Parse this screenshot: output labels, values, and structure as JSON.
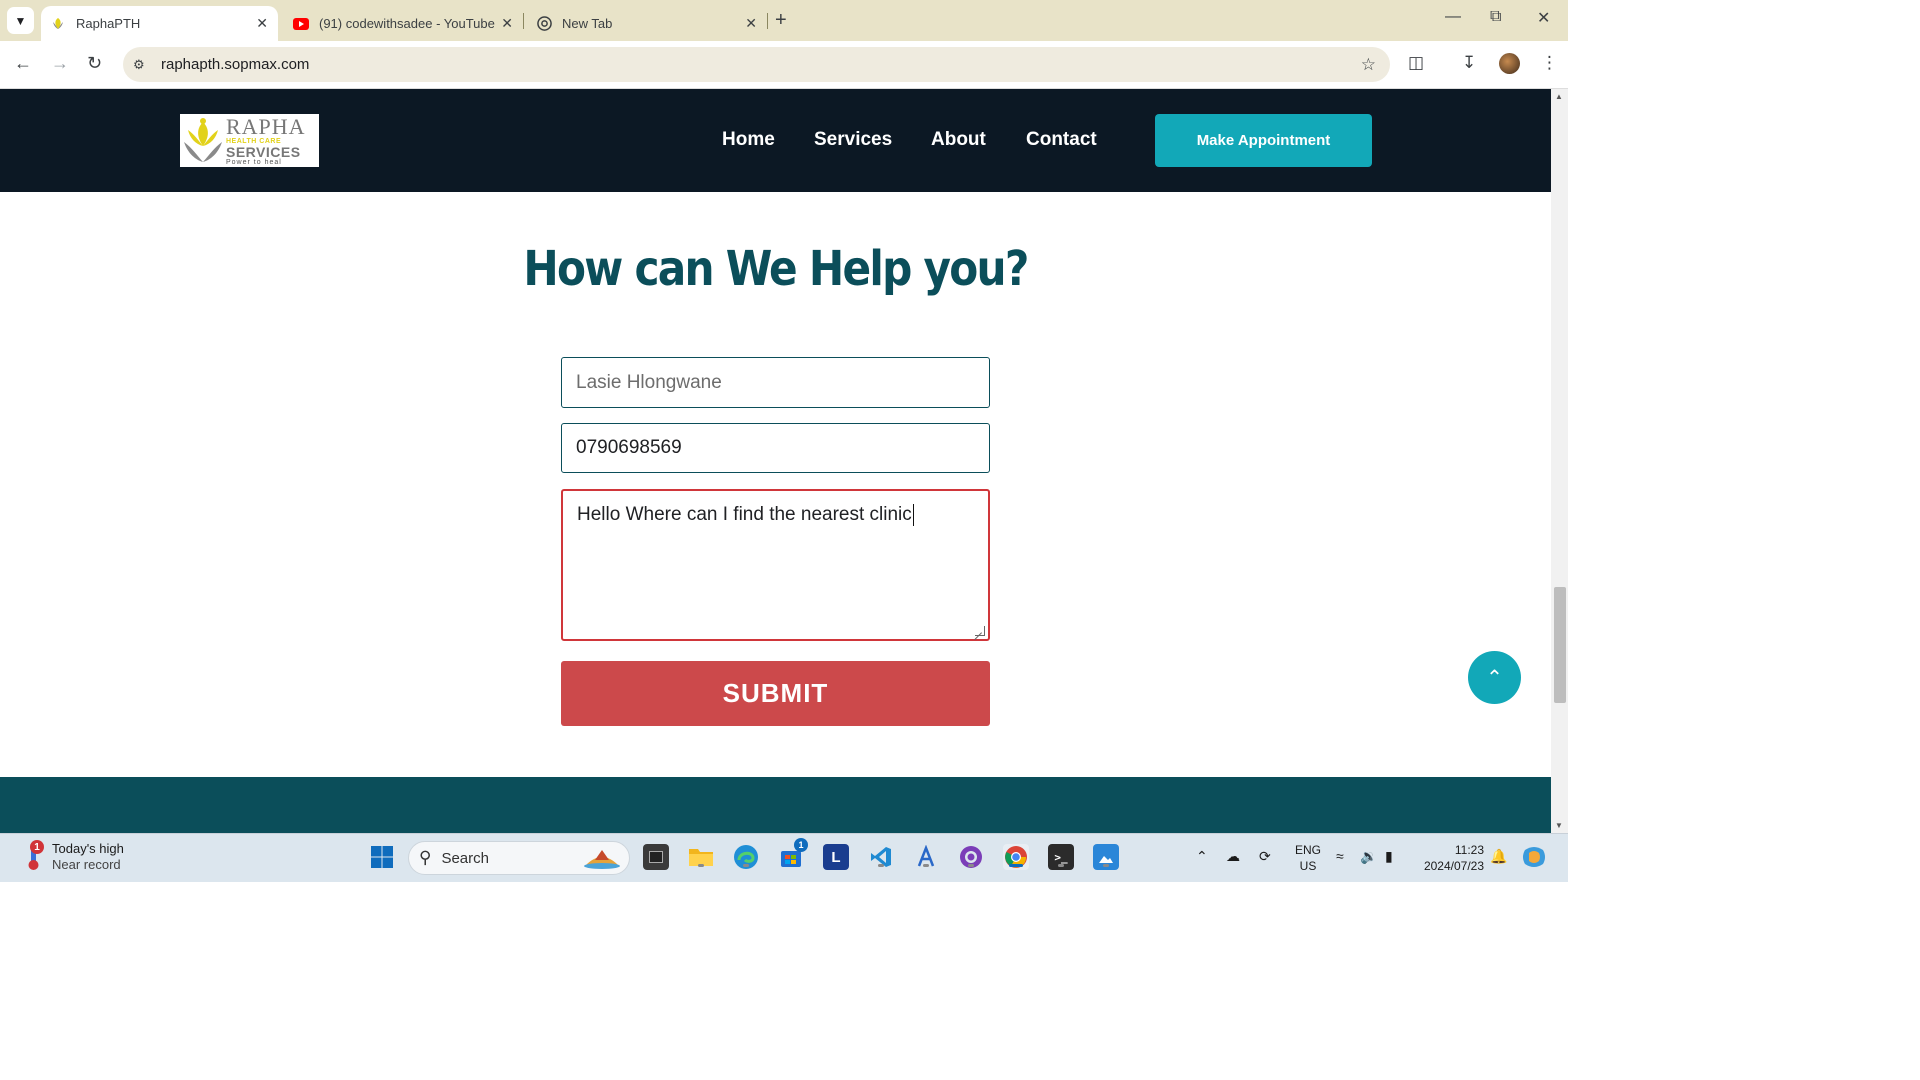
{
  "browser": {
    "tabs": [
      {
        "title": "RaphaPTH",
        "active": true
      },
      {
        "title": "(91) codewithsadee - YouTube",
        "active": false
      },
      {
        "title": "New Tab",
        "active": false
      }
    ],
    "url": "raphapth.sopmax.com"
  },
  "site": {
    "logo": {
      "line1": "RAPHA",
      "line2": "HEALTH CARE",
      "line3": "SERVICES",
      "line4": "Power to heal"
    },
    "nav": [
      "Home",
      "Services",
      "About",
      "Contact"
    ],
    "cta": "Make Appointment",
    "heading": "How can We Help you?",
    "form": {
      "name_value": "Lasie Hlongwane",
      "phone_value": "0790698569",
      "message_value": "Hello Where can I find the nearest clinic",
      "submit_label": "SUBMIT"
    }
  },
  "taskbar": {
    "weather_title": "Today's high",
    "weather_sub": "Near record",
    "weather_badge": "1",
    "search_placeholder": "Search",
    "store_badge": "1",
    "lang_top": "ENG",
    "lang_bottom": "US",
    "time": "11:23",
    "date": "2024/07/23"
  },
  "colors": {
    "nav_bg": "#0c1824",
    "accent": "#12a8b8",
    "heading": "#0b4e5a",
    "submit": "#cc494b"
  }
}
